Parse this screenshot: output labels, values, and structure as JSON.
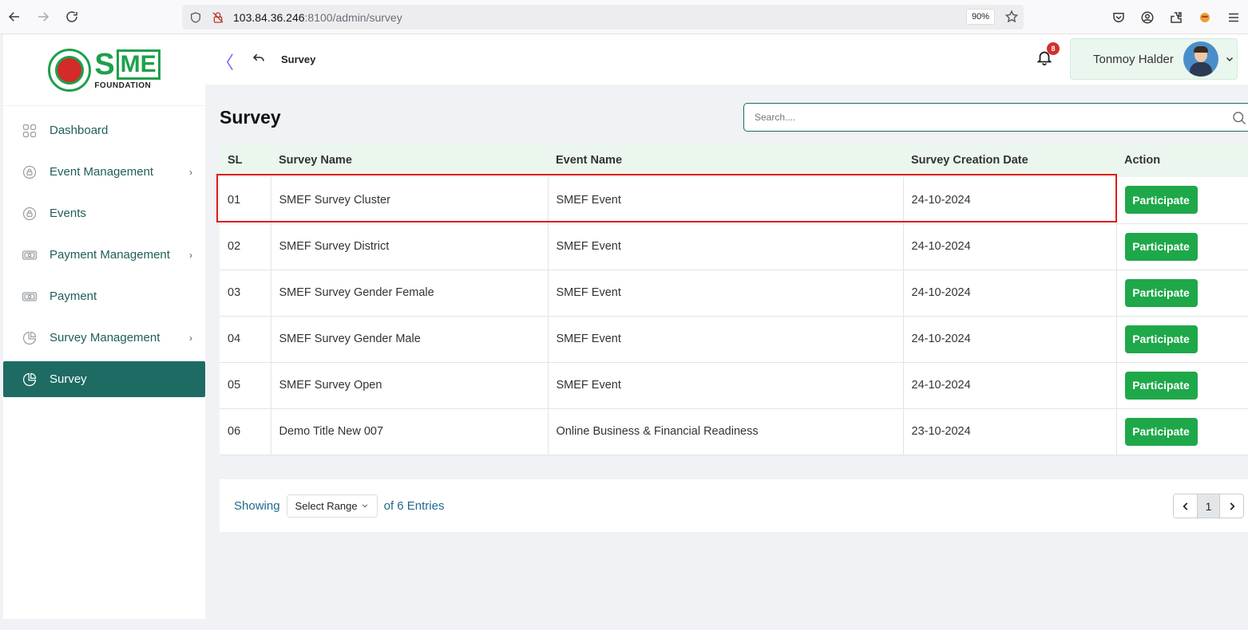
{
  "browser": {
    "url_host": "103.84.36.246",
    "url_path": ":8100/admin/survey",
    "zoom": "90%"
  },
  "sidebar": {
    "brand": {
      "word_s": "S",
      "word_box": "ME",
      "sub": "FOUNDATION"
    },
    "items": [
      {
        "label": "Dashboard",
        "icon": "grid-icon",
        "expandable": false,
        "active": false
      },
      {
        "label": "Event Management",
        "icon": "lock-circle-icon",
        "expandable": true,
        "active": false
      },
      {
        "label": "Events",
        "icon": "lock-circle-icon",
        "expandable": false,
        "active": false
      },
      {
        "label": "Payment Management",
        "icon": "cash-icon",
        "expandable": true,
        "active": false
      },
      {
        "label": "Payment",
        "icon": "cash-icon",
        "expandable": false,
        "active": false
      },
      {
        "label": "Survey Management",
        "icon": "pie-chart-icon",
        "expandable": true,
        "active": false
      },
      {
        "label": "Survey",
        "icon": "pie-chart-icon",
        "expandable": false,
        "active": true
      }
    ],
    "chevron": "›"
  },
  "header": {
    "collapse": "〈",
    "breadcrumb": "Survey",
    "notification_count": "8",
    "user_name": "Tonmoy Halder"
  },
  "main": {
    "title": "Survey",
    "search_placeholder": "Search....",
    "columns": [
      "SL",
      "Survey Name",
      "Event Name",
      "Survey Creation Date",
      "Action"
    ],
    "action_label": "Participate",
    "rows": [
      {
        "sl": "01",
        "survey": "SMEF Survey Cluster",
        "event": "SMEF Event",
        "date": "24-10-2024"
      },
      {
        "sl": "02",
        "survey": "SMEF Survey District",
        "event": "SMEF Event",
        "date": "24-10-2024"
      },
      {
        "sl": "03",
        "survey": "SMEF Survey Gender Female",
        "event": "SMEF Event",
        "date": "24-10-2024"
      },
      {
        "sl": "04",
        "survey": "SMEF Survey Gender Male",
        "event": "SMEF Event",
        "date": "24-10-2024"
      },
      {
        "sl": "05",
        "survey": "SMEF Survey Open",
        "event": "SMEF Event",
        "date": "24-10-2024"
      },
      {
        "sl": "06",
        "survey": "Demo Title New 007",
        "event": "Online Business & Financial Readiness",
        "date": "23-10-2024"
      }
    ]
  },
  "footer": {
    "showing": "Showing",
    "range": "Select Range",
    "entries": "of 6 Entries",
    "current_page": "1"
  },
  "colors": {
    "accent": "#1e6b64",
    "button_green": "#1ea84a",
    "highlight_red": "#e11d1d"
  }
}
